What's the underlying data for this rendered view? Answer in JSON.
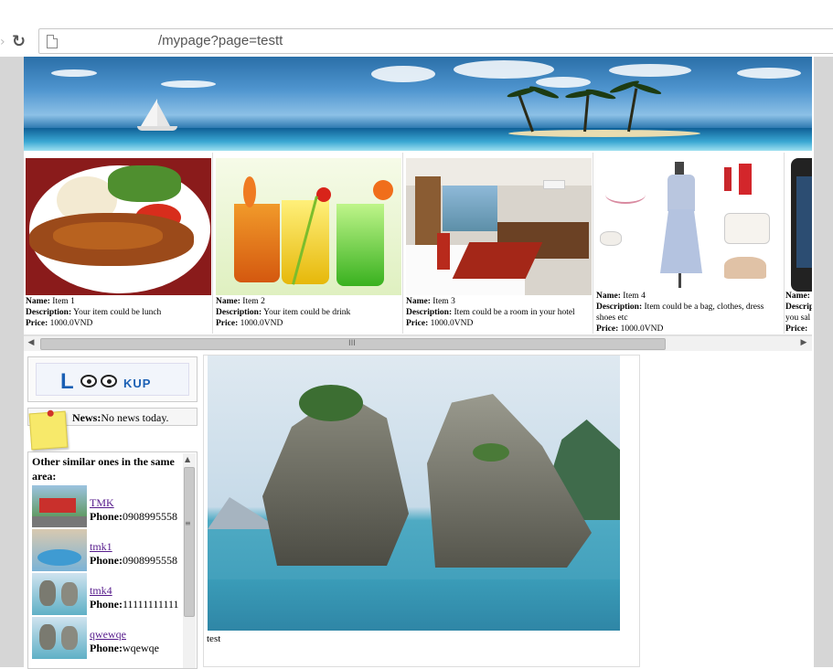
{
  "browser": {
    "url": "/mypage?page=testt",
    "reload_icon": "reload-icon"
  },
  "items": [
    {
      "name_label": "Name:",
      "name": " Item 1",
      "desc_label": "Description:",
      "desc": " Your item could be lunch",
      "price_label": "Price:",
      "price": " 1000.0VND"
    },
    {
      "name_label": "Name:",
      "name": " Item 2",
      "desc_label": "Description:",
      "desc": " Your item could be drink",
      "price_label": "Price:",
      "price": " 1000.0VND"
    },
    {
      "name_label": "Name:",
      "name": " Item 3",
      "desc_label": "Description:",
      "desc": " Item could be a room in your hotel",
      "price_label": "Price:",
      "price": " 1000.0VND"
    },
    {
      "name_label": "Name:",
      "name": " Item 4",
      "desc_label": "Description:",
      "desc": " Item could be a bag, clothes, dress shoes etc",
      "price_label": "Price:",
      "price": " 1000.0VND"
    },
    {
      "name_label": "Name:",
      "name": "",
      "desc_label": "Descrip",
      "desc": "you sal",
      "price_label": "Price:",
      "price": ""
    }
  ],
  "scrollbar": {
    "left_arrow": "◀",
    "right_arrow": "▶",
    "grip": "III"
  },
  "sidebar": {
    "logo_text_l": "L",
    "logo_text_kup": "KUP",
    "news_label": "News:",
    "news_text": "No news today.",
    "similar_title": "Other similar ones in the same area:",
    "similar_items": [
      {
        "name": "TMK ",
        "phone_label": "Phone:",
        "phone": "0908995558"
      },
      {
        "name": "tmk1 ",
        "phone_label": "Phone:",
        "phone": "0908995558"
      },
      {
        "name": "tmk4 ",
        "phone_label": "Phone:",
        "phone": "11111111111"
      },
      {
        "name": "qwewqe ",
        "phone_label": "Phone:",
        "phone": "wqewqe"
      }
    ],
    "vscroll_up": "▲",
    "vscroll_grip": "≡"
  },
  "main": {
    "caption": "test"
  },
  "colors": {
    "link": "#551a8b",
    "logo": "#1a5fb4"
  }
}
